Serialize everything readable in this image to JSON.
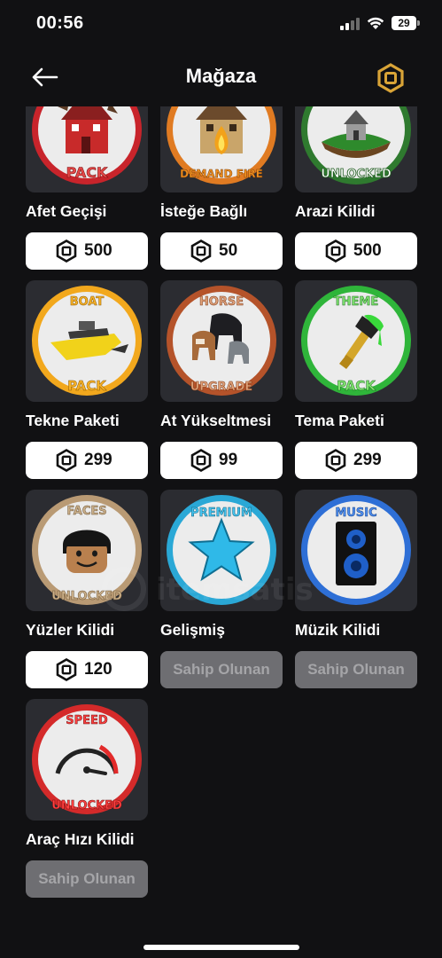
{
  "status_bar": {
    "time": "00:56",
    "battery": "29"
  },
  "header": {
    "title": "Mağaza"
  },
  "items": [
    {
      "name": "Afet Geçişi",
      "badge_top": "",
      "badge_bottom": "PACK",
      "price": "500",
      "owned": false
    },
    {
      "name": "İsteğe Bağlı",
      "badge_top": "",
      "badge_bottom": "DEMAND FIRE",
      "price": "50",
      "owned": false
    },
    {
      "name": "Arazi Kilidi",
      "badge_top": "",
      "badge_bottom": "UNLOCKED",
      "price": "500",
      "owned": false
    },
    {
      "name": "Tekne Paketi",
      "badge_top": "BOAT",
      "badge_bottom": "PACK",
      "price": "299",
      "owned": false
    },
    {
      "name": "At Yükseltmesi",
      "badge_top": "HORSE",
      "badge_bottom": "UPGRADE",
      "price": "99",
      "owned": false
    },
    {
      "name": "Tema Paketi",
      "badge_top": "THEME",
      "badge_bottom": "PACK",
      "price": "299",
      "owned": false
    },
    {
      "name": "Yüzler Kilidi",
      "badge_top": "FACES",
      "badge_bottom": "UNLOCKED",
      "price": "120",
      "owned": false
    },
    {
      "name": "Gelişmiş",
      "badge_top": "PREMIUM",
      "badge_bottom": "",
      "owned_label": "Sahip Olunan",
      "owned": true
    },
    {
      "name": "Müzik Kilidi",
      "badge_top": "MUSIC",
      "badge_bottom": "",
      "owned_label": "Sahip Olunan",
      "owned": true
    },
    {
      "name": "Araç Hızı Kilidi",
      "badge_top": "SPEED",
      "badge_bottom": "UNLOCKED",
      "owned_label": "Sahip Olunan",
      "owned": true
    }
  ],
  "watermark": "itemsatis",
  "colors": {
    "background": "#111113",
    "card": "#2b2c31",
    "robux_gold": "#d9a437",
    "owned_button": "#6e6e72"
  }
}
